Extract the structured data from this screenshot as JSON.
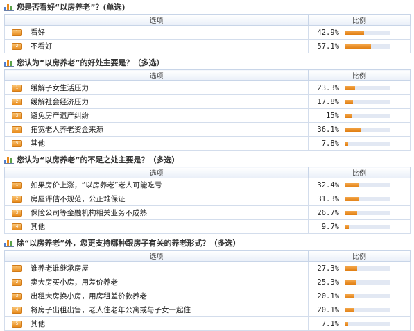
{
  "header": {
    "option_col": "选项",
    "ratio_col": "比例"
  },
  "polls": [
    {
      "title": "您是否看好“以房养老”？(单选)",
      "options": [
        {
          "n": "1",
          "label": "看好",
          "pct": "42.9%",
          "value": 42.9
        },
        {
          "n": "2",
          "label": "不看好",
          "pct": "57.1%",
          "value": 57.1
        }
      ]
    },
    {
      "title": "您认为“以房养老”的好处主要是？（多选）",
      "options": [
        {
          "n": "1",
          "label": "缓解子女生活压力",
          "pct": "23.3%",
          "value": 23.3
        },
        {
          "n": "2",
          "label": "缓解社会经济压力",
          "pct": "17.8%",
          "value": 17.8
        },
        {
          "n": "3",
          "label": "避免房产遗产纠纷",
          "pct": "15%",
          "value": 15
        },
        {
          "n": "4",
          "label": "拓宽老人养老资金来源",
          "pct": "36.1%",
          "value": 36.1
        },
        {
          "n": "5",
          "label": "其他",
          "pct": "7.8%",
          "value": 7.8
        }
      ]
    },
    {
      "title": "您认为“以房养老”的不足之处主要是？（多选）",
      "options": [
        {
          "n": "1",
          "label": "如果房价上涨，“以房养老”老人可能吃亏",
          "pct": "32.4%",
          "value": 32.4
        },
        {
          "n": "2",
          "label": "房屋评估不规范，公正难保证",
          "pct": "31.3%",
          "value": 31.3
        },
        {
          "n": "3",
          "label": "保险公司等金融机构相关业务不成熟",
          "pct": "26.7%",
          "value": 26.7
        },
        {
          "n": "4",
          "label": "其他",
          "pct": "9.7%",
          "value": 9.7
        }
      ]
    },
    {
      "title": "除“以房养老”外，您更支持哪种跟房子有关的养老形式？（多选）",
      "options": [
        {
          "n": "1",
          "label": "谁养老谁继承房屋",
          "pct": "27.3%",
          "value": 27.3
        },
        {
          "n": "2",
          "label": "卖大房买小房，用差价养老",
          "pct": "25.3%",
          "value": 25.3
        },
        {
          "n": "3",
          "label": "出租大房换小房，用房租差价款养老",
          "pct": "20.1%",
          "value": 20.1
        },
        {
          "n": "4",
          "label": "将房子出租出售，老人住老年公寓或与子女一起住",
          "pct": "20.1%",
          "value": 20.1
        },
        {
          "n": "5",
          "label": "其他",
          "pct": "7.1%",
          "value": 7.1
        }
      ]
    }
  ]
}
